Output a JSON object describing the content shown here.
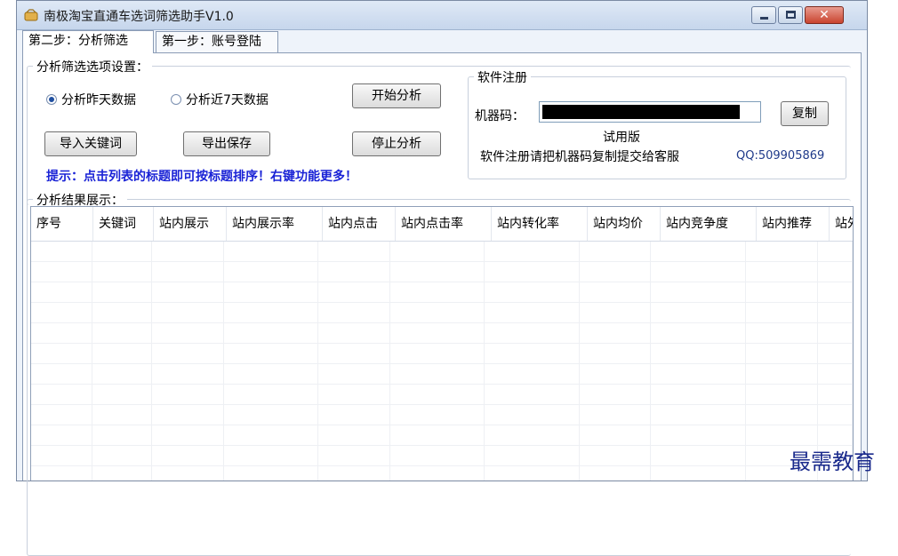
{
  "window": {
    "title": "南极淘宝直通车选词筛选助手V1.0"
  },
  "tabs": [
    {
      "label": "第二步：分析筛选",
      "active": true
    },
    {
      "label": "第一步：账号登陆",
      "active": false
    }
  ],
  "options_group": {
    "title": "分析筛选选项设置：",
    "radio_yesterday": "分析昨天数据",
    "radio_7days": "分析近7天数据",
    "selected": "radio_yesterday",
    "btn_start": "开始分析",
    "btn_import": "导入关键词",
    "btn_export": "导出保存",
    "btn_stop": "停止分析",
    "hint": "提示：点击列表的标题即可按标题排序！右键功能更多！"
  },
  "register_group": {
    "title": "软件注册",
    "machine_code_label": "机器码：",
    "copy_button": "复制",
    "edition": "试用版",
    "instruction": "软件注册请把机器码复制提交给客服",
    "qq": "QQ:509905869"
  },
  "results_group": {
    "title": "分析结果展示：",
    "columns": [
      "序号",
      "关键词",
      "站内展示",
      "站内展示率",
      "站内点击",
      "站内点击率",
      "站内转化率",
      "站内均价",
      "站内竞争度",
      "站内推荐",
      "站外"
    ]
  },
  "watermark": "最需教育",
  "colors": {
    "hint_text": "#1a23d6",
    "close_button": "#c9442f",
    "title_bar": "#c6d6ec"
  }
}
